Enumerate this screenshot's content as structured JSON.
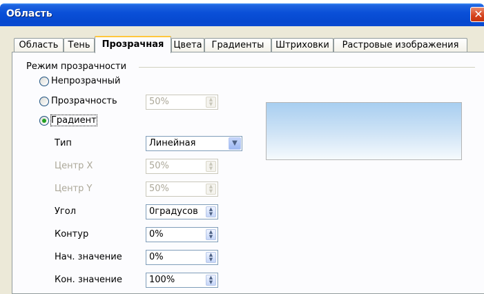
{
  "window": {
    "title": "Область",
    "close_glyph": "✕"
  },
  "tabs": [
    {
      "label": "Область"
    },
    {
      "label": "Тень"
    },
    {
      "label": "Прозрачная",
      "active": true
    },
    {
      "label": "Цвета"
    },
    {
      "label": "Градиенты"
    },
    {
      "label": "Штриховки"
    },
    {
      "label": "Растровые изображения"
    }
  ],
  "transparency": {
    "group_label": "Режим прозрачности",
    "radios": {
      "opaque": "Непрозрачный",
      "transparency": "Прозрачность",
      "gradient": "Градиент"
    },
    "transparency_value": "50%",
    "selected": "gradient"
  },
  "gradient": {
    "type_label": "Тип",
    "type_value": "Линейная",
    "center_x_label": "Центр X",
    "center_x_value": "50%",
    "center_y_label": "Центр Y",
    "center_y_value": "50%",
    "angle_label": "Угол",
    "angle_value": "0градусов",
    "border_label": "Контур",
    "border_value": "0%",
    "start_label": "Нач. значение",
    "start_value": "0%",
    "end_label": "Кон. значение",
    "end_value": "100%"
  },
  "icons": {
    "spin": "spin-arrows-icon",
    "dropdown": "chevron-down-icon",
    "close": "close-icon"
  },
  "colors": {
    "titlebar": "#0a50d8",
    "dialog": "#ece9d8",
    "active_tab_accent": "#ffc73c",
    "preview_top": "#a8cef0"
  }
}
